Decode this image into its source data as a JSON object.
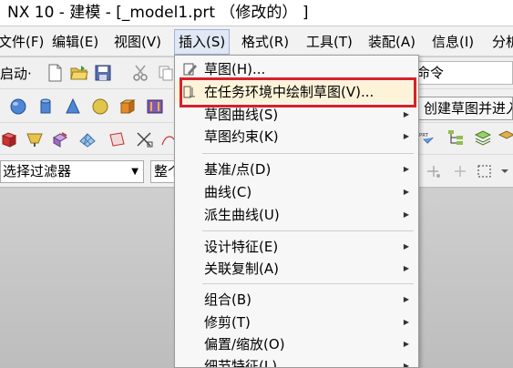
{
  "window": {
    "title": "NX 10 - 建模 - [_model1.prt （修改的） ]"
  },
  "menubar": {
    "items": [
      {
        "label": "文件(F)"
      },
      {
        "label": "编辑(E)"
      },
      {
        "label": "视图(V)"
      },
      {
        "label": "插入(S)"
      },
      {
        "label": "格式(R)"
      },
      {
        "label": "工具(T)"
      },
      {
        "label": "装配(A)"
      },
      {
        "label": "信息(I)"
      },
      {
        "label": "分析"
      }
    ],
    "active_index": 3
  },
  "toolbar": {
    "start_label": "启动·",
    "command_search": "命令",
    "selection_filter": "选择过滤器",
    "scope": "整个装配"
  },
  "tooltip": {
    "text": "创建草图并进入"
  },
  "insert_menu": {
    "items": [
      {
        "label": "草图(H)...",
        "icon": "sketch-icon",
        "submenu": false
      },
      {
        "label": "在任务环境中绘制草图(V)...",
        "icon": "task-sketch-icon",
        "submenu": false,
        "highlighted": true
      },
      {
        "label": "草图曲线(S)",
        "submenu": true
      },
      {
        "label": "草图约束(K)",
        "submenu": true
      },
      {
        "label": "基准/点(D)",
        "submenu": true
      },
      {
        "label": "曲线(C)",
        "submenu": true
      },
      {
        "label": "派生曲线(U)",
        "submenu": true
      },
      {
        "label": "设计特征(E)",
        "submenu": true
      },
      {
        "label": "关联复制(A)",
        "submenu": true
      },
      {
        "label": "组合(B)",
        "submenu": true
      },
      {
        "label": "修剪(T)",
        "submenu": true
      },
      {
        "label": "偏置/缩放(O)",
        "submenu": true
      },
      {
        "label": "细节特征(L)",
        "submenu": true
      }
    ]
  },
  "colors": {
    "highlight_border": "#d8202a",
    "menu_highlight": "#fdf3d8",
    "menu_active": "#dfe8f4"
  }
}
